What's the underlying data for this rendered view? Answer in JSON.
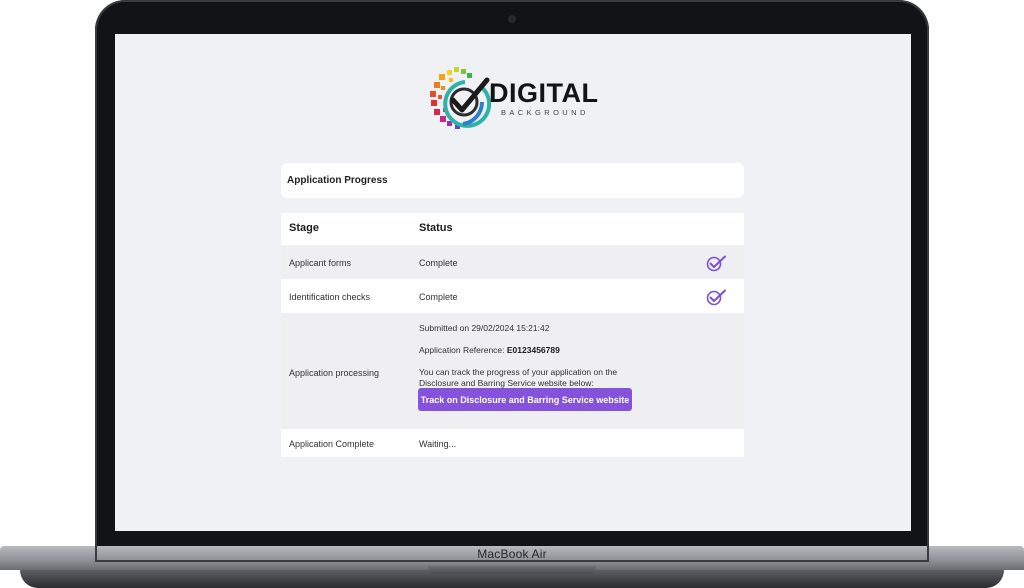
{
  "device": {
    "label": "MacBook Air"
  },
  "logo": {
    "title": "DIGITAL",
    "subtitle": "BACKGROUND"
  },
  "progress": {
    "title": "Application Progress"
  },
  "table": {
    "headers": {
      "stage": "Stage",
      "status": "Status"
    },
    "rows": [
      {
        "stage": "Applicant forms",
        "status": "Complete"
      },
      {
        "stage": "Identification checks",
        "status": "Complete"
      },
      {
        "stage": "Application processing"
      },
      {
        "stage": "Application Complete",
        "status": "Waiting..."
      }
    ]
  },
  "processing": {
    "submitted": "Submitted on 29/02/2024 15:21:42",
    "reference_label": "Application Reference: ",
    "reference_value": "E0123456789",
    "track_text_1": "You can track the progress of your application on the",
    "track_text_2": "Disclosure and Barring Service website below:",
    "track_button": "Track on Disclosure and Barring Service website"
  },
  "colors": {
    "accent": "#8452db",
    "check": "#7b4fd6",
    "screen_bg": "#f0f1f5"
  },
  "icons": {
    "check": "check-badge-icon",
    "logo": "digital-background-logo-mark"
  }
}
